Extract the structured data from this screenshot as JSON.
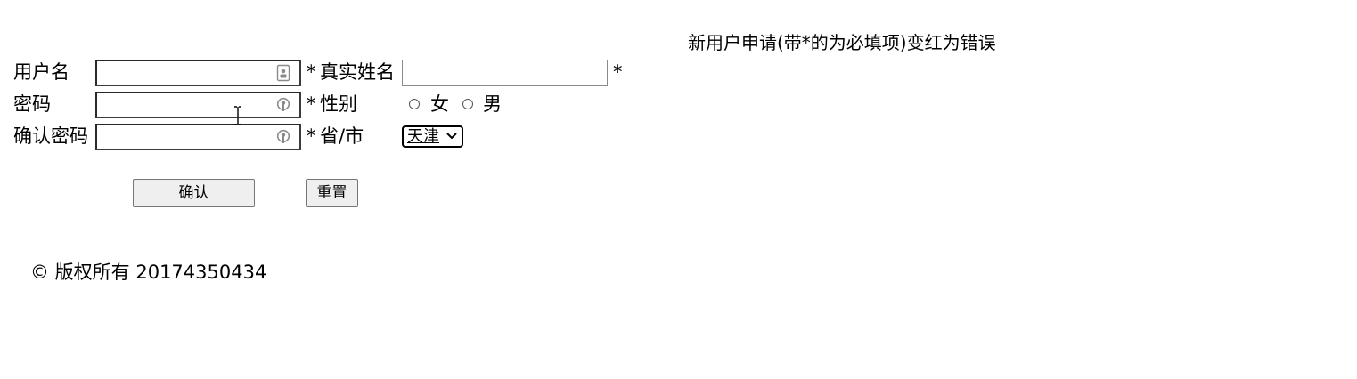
{
  "heading": "新用户申请(带*的为必填项)变红为错误",
  "form": {
    "username": {
      "label": "用户名",
      "value": "",
      "required_mark": "*"
    },
    "real_name": {
      "label": "真实姓名",
      "value": "",
      "required_mark": "*"
    },
    "password": {
      "label": "密码",
      "value": "",
      "required_mark": "*"
    },
    "gender": {
      "label": "性别",
      "options": [
        "女",
        "男"
      ]
    },
    "confirm_password": {
      "label": "确认密码",
      "value": "",
      "required_mark": "*"
    },
    "province": {
      "label": "省/市",
      "selected": "天津"
    }
  },
  "buttons": {
    "confirm": "确认",
    "reset": "重置"
  },
  "footer": "© 版权所有 20174350434",
  "icons": {
    "username_field": "contact-card-icon",
    "password_field": "key-icon",
    "confirm_password_field": "key-icon",
    "select_arrow": "chevron-down-icon",
    "cursor": "text-cursor-icon"
  }
}
